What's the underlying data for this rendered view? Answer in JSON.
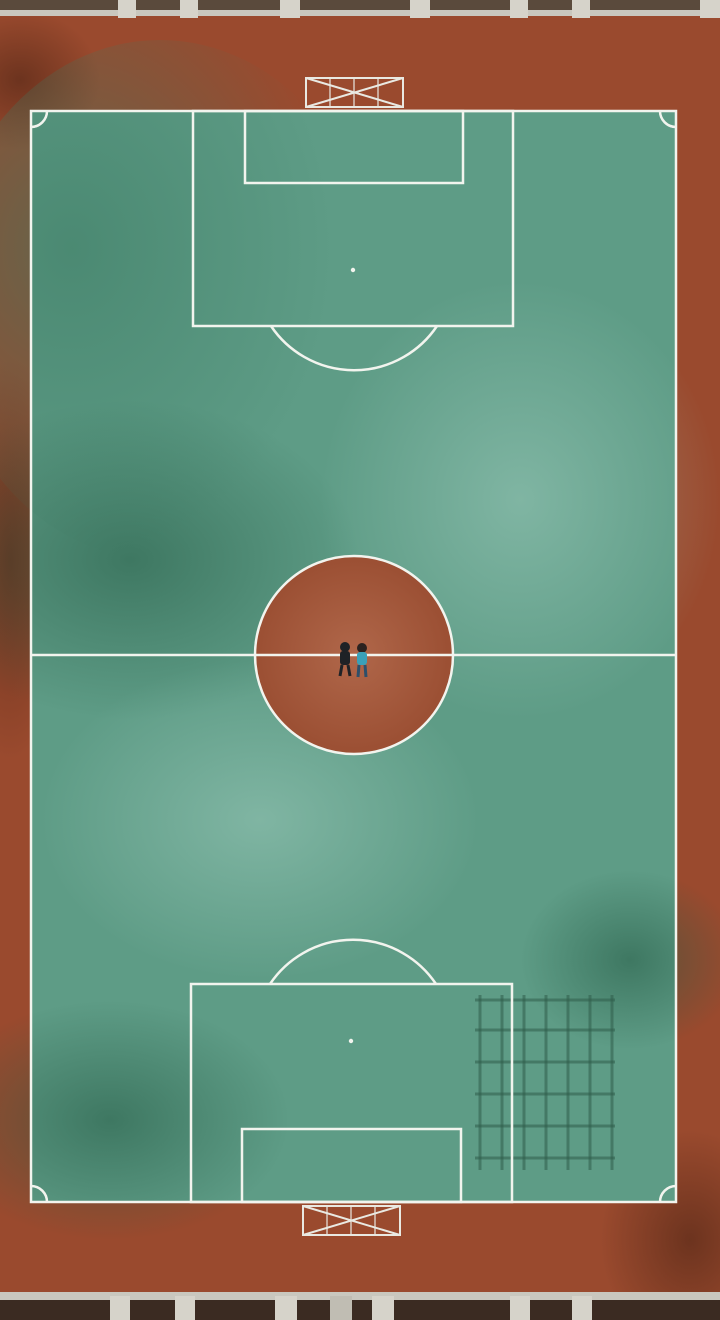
{
  "scene": {
    "description_visible_text": "",
    "colors": {
      "track_clay": "#9a4a2e",
      "track_clay_dark": "#6e3520",
      "pitch_green": "#5e9c86",
      "pitch_green_dark": "#2f6a52",
      "pitch_green_light": "#8cbfae",
      "center_circle_clay": "#a65a3e",
      "line_white": "#f2f4ee",
      "railing": "#c9c7be",
      "player_dark": "#1f2226",
      "player_teal": "#3aa0b8"
    },
    "people_count": 2
  }
}
